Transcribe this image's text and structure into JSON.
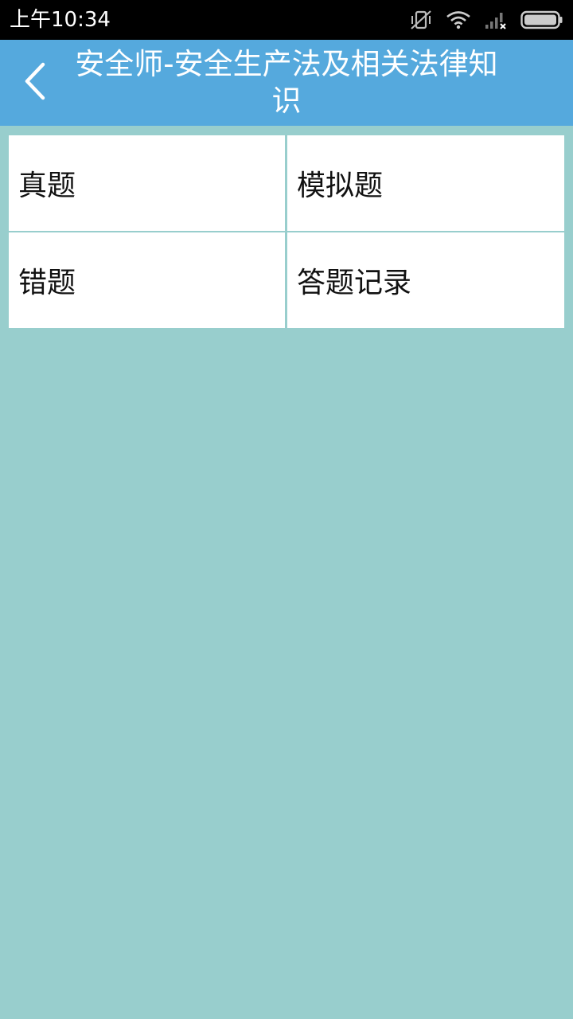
{
  "status_bar": {
    "time": "上午10:34",
    "icons": [
      "vibrate-off-icon",
      "wifi-icon",
      "signal-no-sim-icon",
      "battery-icon"
    ]
  },
  "header": {
    "back_icon": "chevron-left-icon",
    "title": "安全师-安全生产法及相关法律知识",
    "background_color": "#55a9dd"
  },
  "menu": {
    "items": [
      {
        "label": "真题"
      },
      {
        "label": "模拟题"
      },
      {
        "label": "错题"
      },
      {
        "label": "答题记录"
      }
    ]
  },
  "colors": {
    "page_background": "#98cecd",
    "cell_background": "#ffffff",
    "status_bar": "#000000"
  }
}
